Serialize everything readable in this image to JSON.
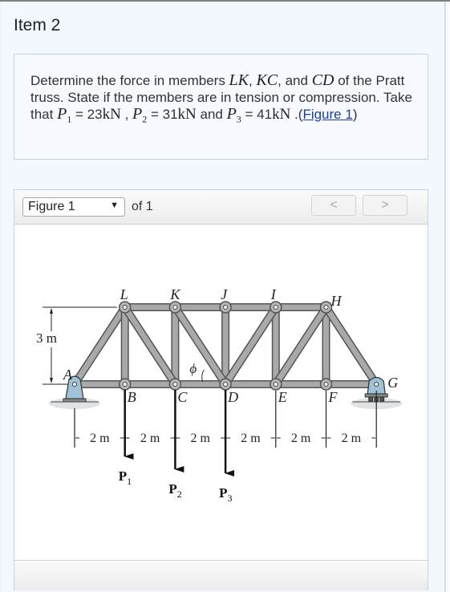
{
  "item": {
    "title": "Item 2"
  },
  "question": {
    "text_1": "Determine the force in members ",
    "m_lk": "LK",
    "sep_1": ", ",
    "m_kc": "KC",
    "sep_2": ", and ",
    "m_cd": "CD",
    "text_2": " of the Pratt truss. State if the members are in tension or compression. Take that ",
    "p1_sym": "P",
    "p1_sub": "1",
    "p1_val": " = 23",
    "p1_unit": "kN",
    "sep_3": " , ",
    "p2_sym": "P",
    "p2_sub": "2",
    "p2_val": " = 31",
    "p2_unit": "kN",
    "text_3": " and ",
    "p3_sym": "P",
    "p3_sub": "3",
    "p3_val": " = 41",
    "p3_unit": "kN",
    "text_4": " .(",
    "figure_link": "Figure 1",
    "text_5": ")"
  },
  "figure": {
    "select_value": "Figure 1",
    "of_label": "of 1",
    "prev_label": "<",
    "next_label": ">"
  },
  "diagram": {
    "top_nodes": [
      "L",
      "K",
      "J",
      "I",
      "H"
    ],
    "bottom_nodes": [
      "A",
      "B",
      "C",
      "D",
      "E",
      "F",
      "G"
    ],
    "height_label": "3 m",
    "angle_label": "ϕ",
    "span_label": "2 m",
    "spans": [
      "2 m",
      "2 m",
      "2 m",
      "2 m",
      "2 m",
      "2 m"
    ],
    "loads": [
      {
        "symbol": "P",
        "sub": "1",
        "node": "B"
      },
      {
        "symbol": "P",
        "sub": "2",
        "node": "C"
      },
      {
        "symbol": "P",
        "sub": "3",
        "node": "D"
      }
    ],
    "member_color": "#a9a9a9",
    "support_color": "#9fc2d8"
  }
}
